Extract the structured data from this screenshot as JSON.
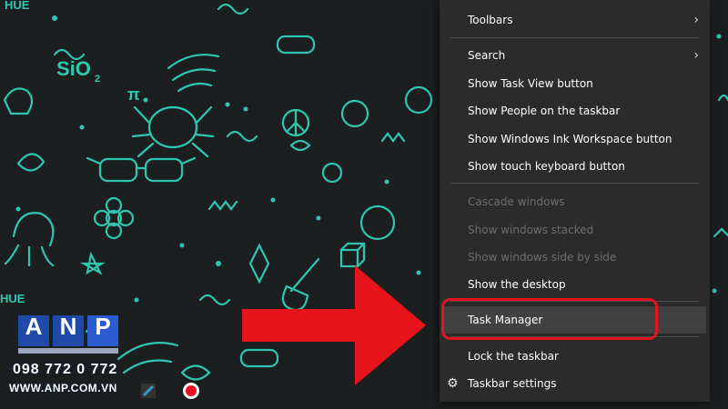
{
  "context_menu": {
    "items": [
      {
        "label": "Toolbars",
        "has_submenu": true,
        "disabled": false
      },
      {
        "label": "Search",
        "has_submenu": true,
        "disabled": false
      },
      {
        "label": "Show Task View button",
        "disabled": false
      },
      {
        "label": "Show People on the taskbar",
        "disabled": false
      },
      {
        "label": "Show Windows Ink Workspace button",
        "disabled": false
      },
      {
        "label": "Show touch keyboard button",
        "disabled": false
      },
      {
        "label": "Cascade windows",
        "disabled": true
      },
      {
        "label": "Show windows stacked",
        "disabled": true
      },
      {
        "label": "Show windows side by side",
        "disabled": true
      },
      {
        "label": "Show the desktop",
        "disabled": false
      },
      {
        "label": "Task Manager",
        "disabled": false,
        "highlighted": true
      },
      {
        "label": "Lock the taskbar",
        "disabled": false
      },
      {
        "label": "Taskbar settings",
        "icon": "gear-icon",
        "disabled": false
      }
    ],
    "chevron_glyph": "›",
    "gear_glyph": "⚙"
  },
  "annotation": {
    "arrow_color": "#e3141f",
    "highlight_color": "#e3141f"
  },
  "watermark": {
    "logo_letters": [
      "A",
      "N",
      "P"
    ],
    "phone": "098 772 0 772",
    "website": "WWW.ANP.COM.VN"
  },
  "colors": {
    "wallpaper_bg": "#1c1f20",
    "doodle": "#2fc7b0",
    "menu_bg": "#2b2b2b"
  }
}
